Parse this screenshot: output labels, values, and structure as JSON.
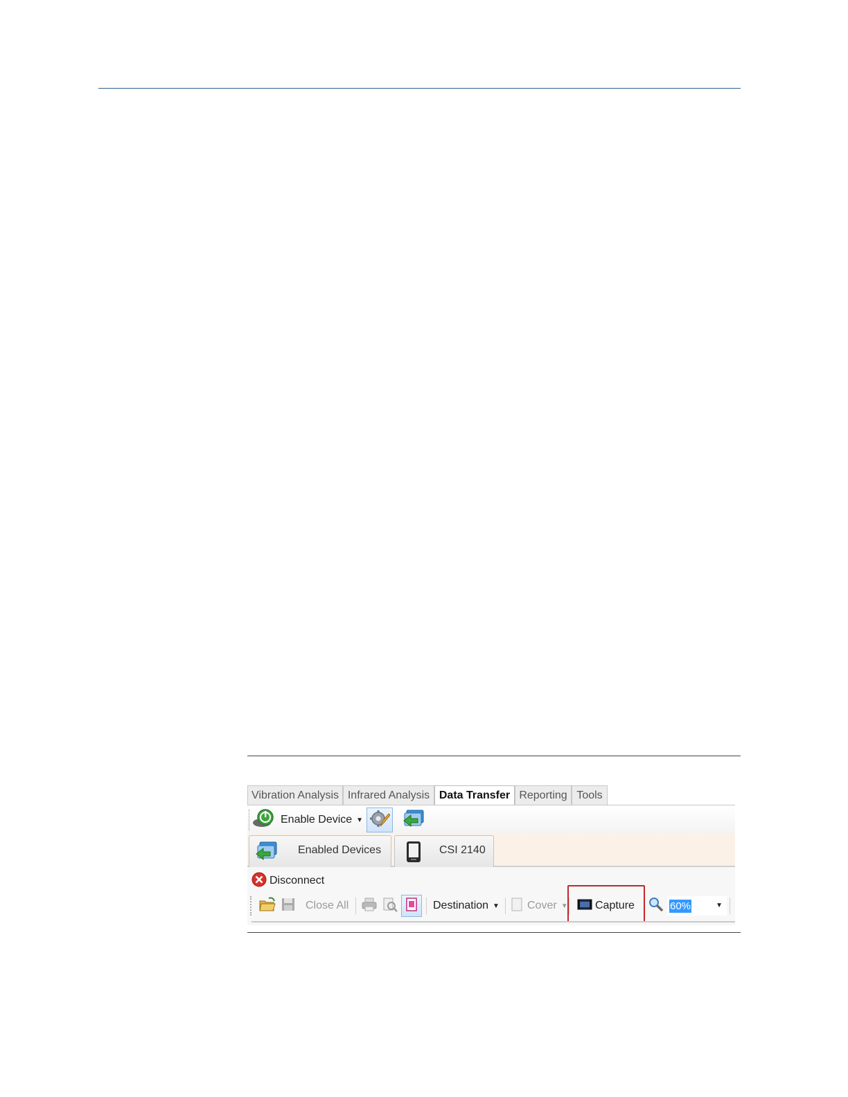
{
  "ribbon": {
    "tabs": [
      {
        "label": "Vibration Analysis",
        "active": false
      },
      {
        "label": "Infrared Analysis",
        "active": false
      },
      {
        "label": "Data Transfer",
        "active": true
      },
      {
        "label": "Reporting",
        "active": false
      },
      {
        "label": "Tools",
        "active": false
      }
    ],
    "enable_device_label": "Enable Device"
  },
  "device_tabs": {
    "enabled_devices_label": "Enabled Devices",
    "device_label": "CSI 2140"
  },
  "connection": {
    "disconnect_label": "Disconnect"
  },
  "report_toolbar": {
    "close_all_label": "Close All",
    "destination_label": "Destination",
    "cover_label": "Cover",
    "capture_label": "Capture",
    "zoom_value": "60%"
  },
  "colors": {
    "highlight": "#c1272d",
    "header_rule": "#2f5f8f",
    "selection": "#3399ff"
  }
}
